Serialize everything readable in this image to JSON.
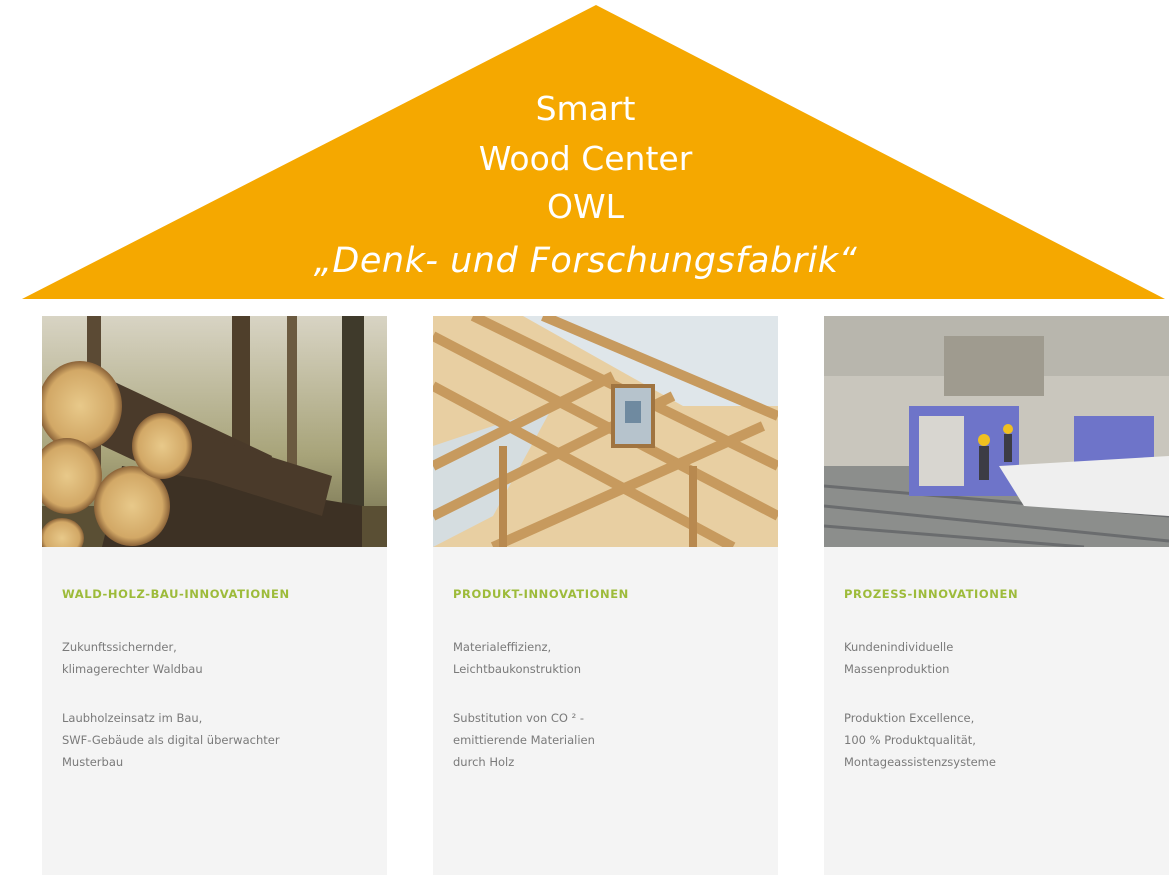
{
  "roof": {
    "line1": "Smart",
    "line2": "Wood Center",
    "line3": "OWL",
    "subtitle": "„Denk- und Forschungsfabrik“",
    "color": "#f5a800"
  },
  "pillars": [
    {
      "heading": "WALD-HOLZ-BAU-INNOVATIONEN",
      "paragraphs": [
        "Zukunftssichernder,\nklimagerechter Waldbau",
        "Laubholzeinsatz im Bau,\nSWF-Gebäude als digital überwachter\nMusterbau"
      ]
    },
    {
      "heading": "PRODUKT-INNOVATIONEN",
      "paragraphs": [
        "Materialeffizienz,\nLeichtbaukonstruktion",
        "Substitution von CO ² -\nemittierende Materialien\ndurch Holz"
      ]
    },
    {
      "heading": "PROZESS-INNOVATIONEN",
      "paragraphs": [
        "Kundenindividuelle\nMassenproduktion",
        "Produktion Excellence,\n100 % Produktqualität,\nMontageassistenzsysteme"
      ]
    }
  ],
  "colors": {
    "heading": "#9dbb3a",
    "body_text": "#7a7a7a",
    "card_bg": "#f4f4f4"
  }
}
